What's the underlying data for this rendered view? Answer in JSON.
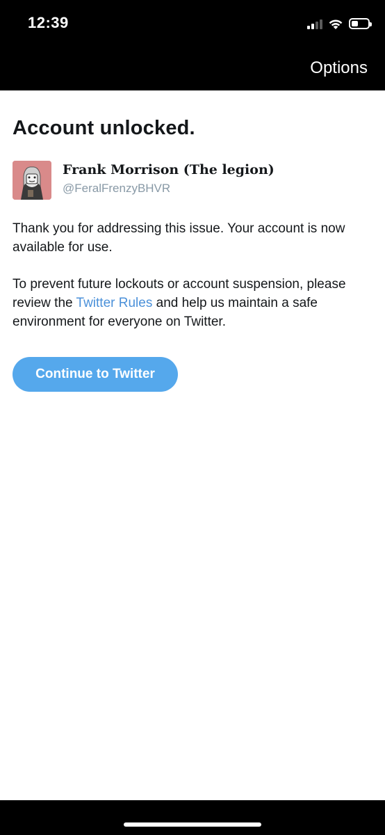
{
  "status_bar": {
    "time": "12:39",
    "battery_level": 0.35
  },
  "nav": {
    "options_label": "Options"
  },
  "main": {
    "title": "Account unlocked.",
    "account": {
      "display_name": "Frank Morrison (The legion)",
      "handle": "@FeralFrenzyBHVR"
    },
    "paragraph1": "Thank you for addressing this issue. Your account is now available for use.",
    "paragraph2_before": "To prevent future lockouts or account suspension, please review the ",
    "paragraph2_link": "Twitter Rules",
    "paragraph2_after": " and help us maintain a safe environment for everyone on Twitter.",
    "continue_label": "Continue to Twitter"
  },
  "colors": {
    "link": "#4a90d9",
    "button": "#55a8ec",
    "handle": "#8899a6"
  },
  "icons": [
    "signal-icon",
    "wifi-icon",
    "battery-icon"
  ]
}
